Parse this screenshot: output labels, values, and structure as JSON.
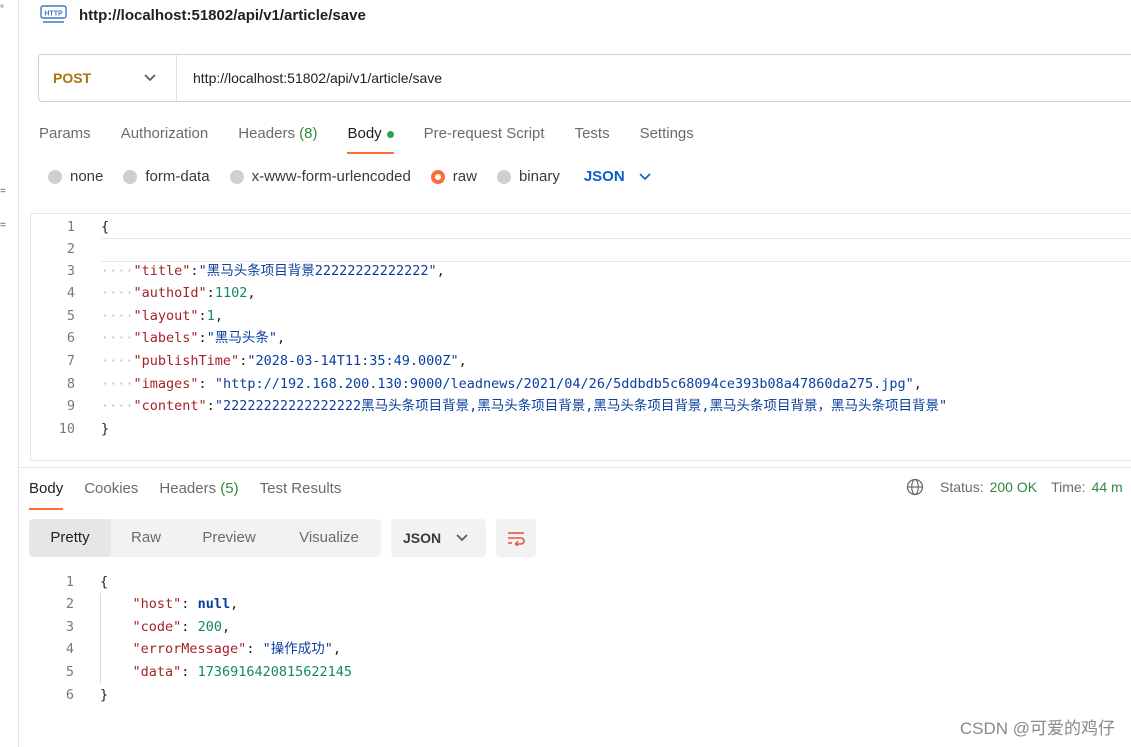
{
  "request": {
    "title": "http://localhost:51802/api/v1/article/save",
    "method": "POST",
    "url": "http://localhost:51802/api/v1/article/save"
  },
  "tabs": [
    {
      "label": "Params"
    },
    {
      "label": "Authorization"
    },
    {
      "label": "Headers",
      "count": "(8)"
    },
    {
      "label": "Body"
    },
    {
      "label": "Pre-request Script"
    },
    {
      "label": "Tests"
    },
    {
      "label": "Settings"
    }
  ],
  "body_types": [
    {
      "label": "none"
    },
    {
      "label": "form-data"
    },
    {
      "label": "x-www-form-urlencoded"
    },
    {
      "label": "raw"
    },
    {
      "label": "binary"
    }
  ],
  "body_format": "JSON",
  "request_body": {
    "line_numbers": [
      "1",
      "2",
      "3",
      "4",
      "5",
      "6",
      "7",
      "8",
      "9",
      "10"
    ],
    "open_brace": "{",
    "close_brace": "}",
    "fields": [
      {
        "key": "\"title\"",
        "sep": ":",
        "value": "\"黑马头条项目背景22222222222222\"",
        "end": ","
      },
      {
        "key": "\"authoId\"",
        "sep": ":",
        "value": "1102",
        "end": ","
      },
      {
        "key": "\"layout\"",
        "sep": ":",
        "value": "1",
        "end": ","
      },
      {
        "key": "\"labels\"",
        "sep": ":",
        "value": "\"黑马头条\"",
        "end": ","
      },
      {
        "key": "\"publishTime\"",
        "sep": ":",
        "value": "\"2028-03-14T11:35:49.000Z\"",
        "end": ","
      },
      {
        "key": "\"images\"",
        "sep": ": ",
        "value": "\"http://192.168.200.130:9000/leadnews/2021/04/26/5ddbdb5c68094ce393b08a47860da275.jpg\"",
        "end": ","
      },
      {
        "key": "\"content\"",
        "sep": ":",
        "value": "\"22222222222222222黑马头条项目背景,黑马头条项目背景,黑马头条项目背景,黑马头条项目背景，黑马头条项目背景\"",
        "end": ""
      }
    ]
  },
  "response_tabs": [
    {
      "label": "Body"
    },
    {
      "label": "Cookies"
    },
    {
      "label": "Headers",
      "count": "(5)"
    },
    {
      "label": "Test Results"
    }
  ],
  "status": {
    "label": "Status:",
    "value": "200 OK",
    "time_label": "Time:",
    "time_value": "44 m"
  },
  "view_modes": [
    "Pretty",
    "Raw",
    "Preview",
    "Visualize"
  ],
  "response_format": "JSON",
  "response_body": {
    "line_numbers": [
      "1",
      "2",
      "3",
      "4",
      "5",
      "6"
    ],
    "open_brace": "{",
    "close_brace": "}",
    "fields": [
      {
        "key": "\"host\"",
        "value": "null",
        "end": ","
      },
      {
        "key": "\"code\"",
        "value": "200",
        "end": ","
      },
      {
        "key": "\"errorMessage\"",
        "value": "\"操作成功\"",
        "end": ","
      },
      {
        "key": "\"data\"",
        "value": "1736916420815622145",
        "end": ""
      }
    ]
  },
  "watermark": "CSDN @可爱的鸡仔",
  "colors": {
    "accent": "#ff6c37",
    "method": "#a8740a",
    "success": "#2f8a3f",
    "link": "#0b5ec5"
  }
}
